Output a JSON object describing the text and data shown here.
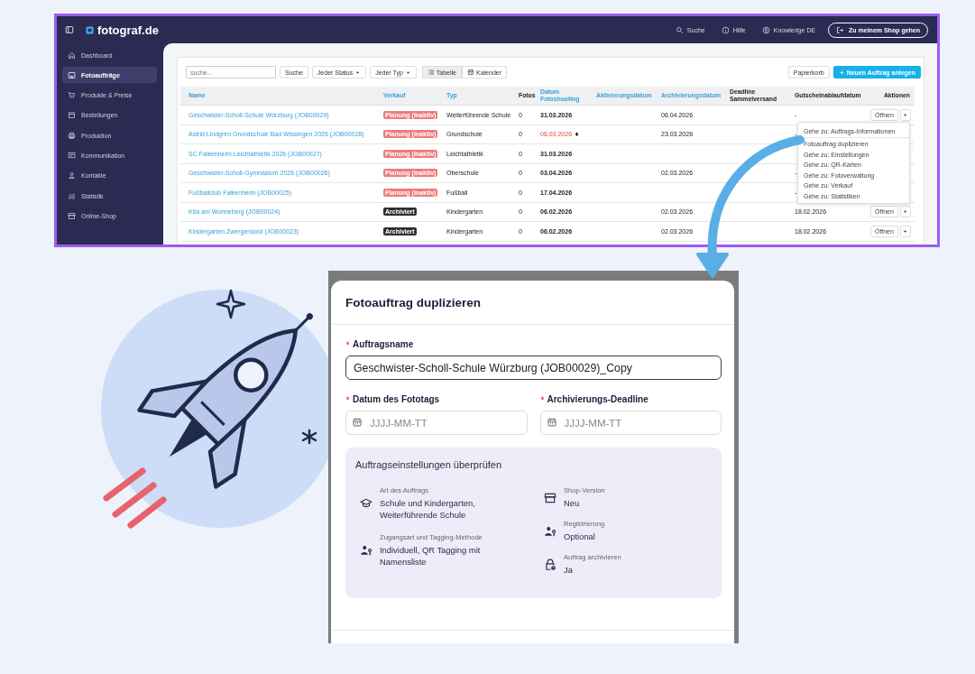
{
  "app": {
    "brand": "fotograf.de",
    "header_links": [
      "Suche",
      "Hilfe",
      "Knowledge DE"
    ],
    "shop_button": "Zu meinem Shop gehen",
    "sidebar": {
      "items": [
        {
          "label": "Dashboard",
          "selected": false
        },
        {
          "label": "Fotoaufträge",
          "selected": true
        },
        {
          "label": "Produkte & Preise",
          "selected": false
        },
        {
          "label": "Bestellungen",
          "selected": false
        },
        {
          "label": "Produktion",
          "selected": false
        },
        {
          "label": "Kommunikation",
          "selected": false
        },
        {
          "label": "Kontakte",
          "selected": false
        },
        {
          "label": "Statistik",
          "selected": false
        },
        {
          "label": "Online-Shop",
          "selected": false
        }
      ]
    },
    "toolbar": {
      "search_placeholder": "suche...",
      "search_button": "Suche",
      "filters": [
        "Jeder Status",
        "Jeder Typ"
      ],
      "views": [
        {
          "label": "Tabelle",
          "selected": true
        },
        {
          "label": "Kalender",
          "selected": false
        }
      ],
      "trash_button": "Papierkorb",
      "new_button": "Neuen Auftrag anlegen"
    },
    "table": {
      "columns": [
        {
          "label": "Name",
          "sortable": true
        },
        {
          "label": "Verkauf",
          "sortable": true
        },
        {
          "label": "Typ",
          "sortable": true
        },
        {
          "label": "Fotos",
          "sortable": false
        },
        {
          "label": "Datum Fotoshooting",
          "sortable": true
        },
        {
          "label": "Aktivierungsdatum",
          "sortable": true
        },
        {
          "label": "Archivierungsdatum",
          "sortable": true
        },
        {
          "label": "Deadline Sammelversand",
          "sortable": false
        },
        {
          "label": "Gutscheinablaufdatum",
          "sortable": false
        },
        {
          "label": "Aktionen",
          "sortable": false
        }
      ],
      "rows": [
        {
          "name": "Geschwister-Scholl-Schule Würzburg (JOB00029)",
          "status": {
            "label": "Planung (inaktiv)",
            "kind": "planning"
          },
          "type": "Weiterführende Schule",
          "photos": "0",
          "shooting_date": "31.03.2026",
          "overdue": false,
          "archive_date": "06.04.2026",
          "voucher_date": "-",
          "open_button": "Öffnen"
        },
        {
          "name": "Astrid Lindgren Grundschule Bad Wissingen 2026 (JOB00028)",
          "status": {
            "label": "Planung (inaktiv)",
            "kind": "planning"
          },
          "type": "Grundschule",
          "photos": "0",
          "shooting_date": "06.03.2026",
          "overdue": true,
          "archive_date": "23.03.2026",
          "voucher_date": "-"
        },
        {
          "name": "SC Falkenheim Leichtathletik 2026 (JOB00027)",
          "status": {
            "label": "Planung (inaktiv)",
            "kind": "planning"
          },
          "type": "Leichtathletik",
          "photos": "0",
          "shooting_date": "31.03.2026",
          "overdue": false
        },
        {
          "name": "Geschwister-Scholl-Gymnasium 2026 (JOB00026)",
          "status": {
            "label": "Planung (inaktiv)",
            "kind": "planning"
          },
          "type": "Oberschule",
          "photos": "0",
          "shooting_date": "03.04.2026",
          "overdue": false,
          "archive_date": "02.03.2026",
          "voucher_date": "-"
        },
        {
          "name": "Fußballclub Falkenheim (JOB00025)",
          "status": {
            "label": "Planung (inaktiv)",
            "kind": "planning"
          },
          "type": "Fußball",
          "photos": "0",
          "shooting_date": "17.04.2026",
          "overdue": false,
          "voucher_date": "-"
        },
        {
          "name": "Kita am Wonneberg (JOB00024)",
          "status": {
            "label": "Archiviert",
            "kind": "archived"
          },
          "type": "Kindergarten",
          "photos": "0",
          "shooting_date": "06.02.2026",
          "overdue": false,
          "archive_date": "02.03.2026",
          "voucher_date": "18.02.2026",
          "open_button": "Öffnen"
        },
        {
          "name": "Kindergarten Zwergenland (JOB00023)",
          "status": {
            "label": "Archiviert",
            "kind": "archived"
          },
          "type": "Kindergarten",
          "photos": "0",
          "shooting_date": "06.02.2026",
          "overdue": false,
          "archive_date": "02.03.2026",
          "voucher_date": "18.02.2026",
          "open_button": "Öffnen"
        }
      ]
    },
    "actions_menu": [
      "Gehe zu: Auftrags-Informationen",
      "Fotoauftrag duplizieren",
      "Gehe zu: Einstellungen",
      "Gehe zu: QR-Karten",
      "Gehe zu: Fotoverwaltung",
      "Gehe zu: Verkauf",
      "Gehe zu: Statistiken"
    ]
  },
  "dialog": {
    "title": "Fotoauftrag duplizieren",
    "name_field": {
      "label": "Auftragsname",
      "required": true,
      "value": "Geschwister-Scholl-Schule Würzburg (JOB00029)_Copy"
    },
    "date_fields": [
      {
        "label": "Datum des Fototags",
        "required": true,
        "placeholder": "JJJJ-MM-TT"
      },
      {
        "label": "Archivierungs-Deadline",
        "required": true,
        "placeholder": "JJJJ-MM-TT"
      }
    ],
    "review": {
      "title": "Auftragseinstellungen überprüfen",
      "left_items": [
        {
          "label": "Art des Auftrags",
          "value": "Schule und Kindergarten, Weiterführende Schule"
        },
        {
          "label": "Zugangsart und Tagging-Methode",
          "value": "Individuell, QR Tagging mit Namensliste"
        }
      ],
      "right_items": [
        {
          "label": "Shop-Version",
          "value": "Neu"
        },
        {
          "label": "Registrierung",
          "value": "Optional"
        },
        {
          "label": "Auftrag archivieren",
          "value": "Ja"
        }
      ]
    }
  }
}
